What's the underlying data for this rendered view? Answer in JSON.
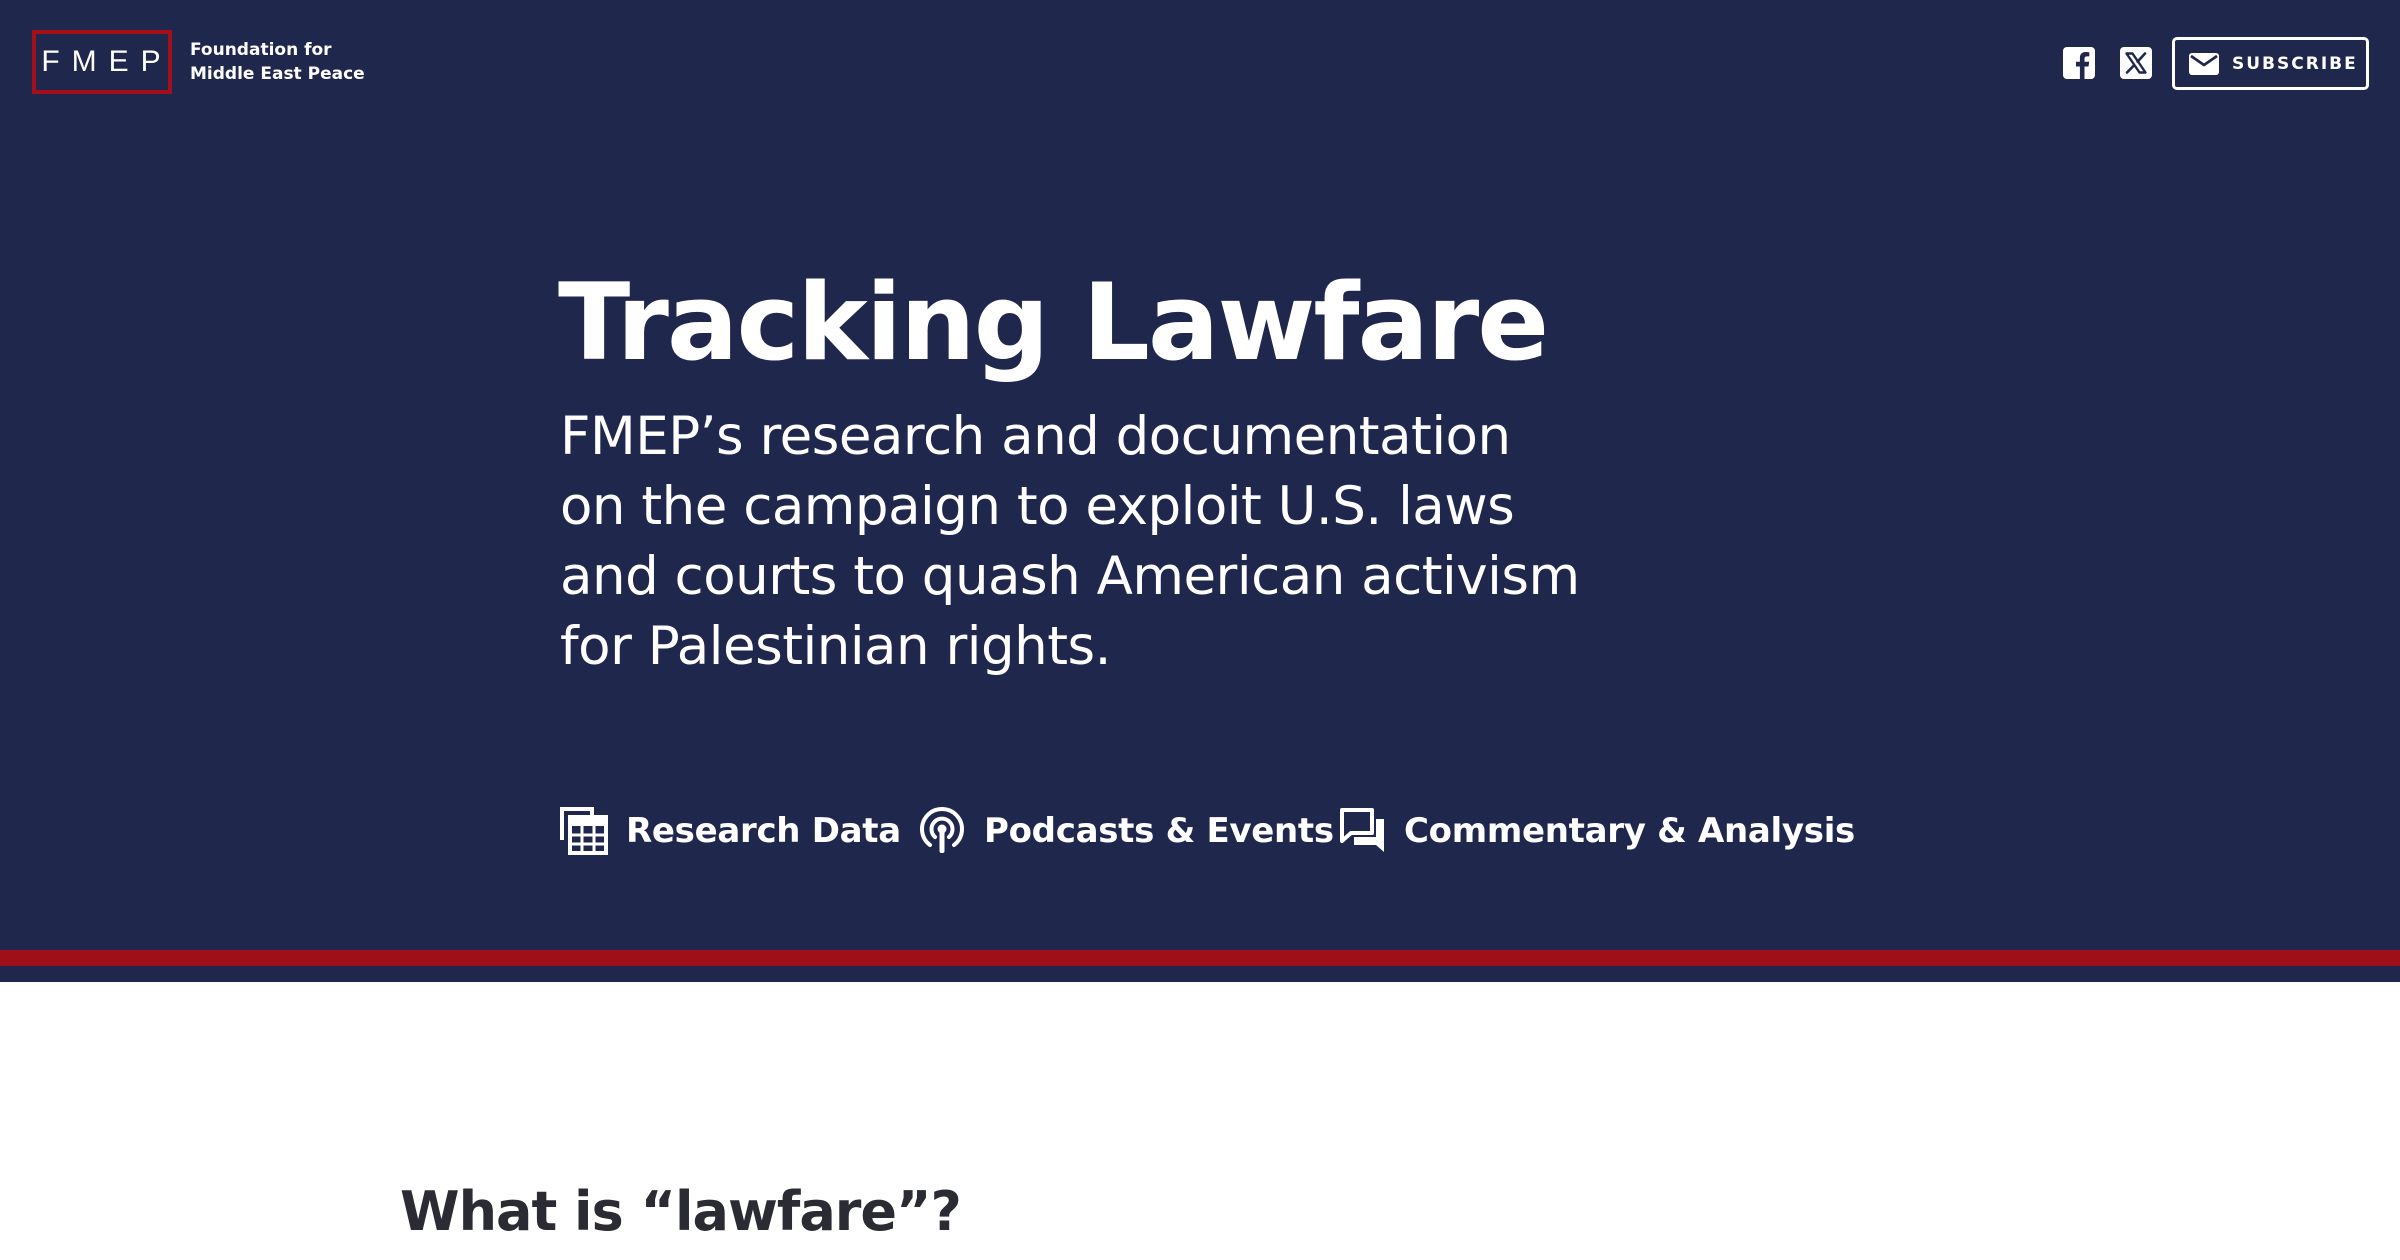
{
  "header": {
    "logo_mark": "FMEP",
    "logo_name_line1": "Foundation for",
    "logo_name_line2": "Middle East Peace",
    "social_icons": [
      "facebook-icon",
      "x-twitter-icon"
    ],
    "subscribe_label": "SUBSCRIBE",
    "subscribe_icon": "envelope-icon"
  },
  "hero": {
    "title": "Tracking Lawfare",
    "subtitle": "FMEP’s research and documentation on the campaign to exploit U.S. laws and courts to quash American activism for Palestinian rights.",
    "links": [
      {
        "label": "Research Data",
        "icon": "spreadsheet-icon"
      },
      {
        "label": "Podcasts & Events",
        "icon": "podcast-icon"
      },
      {
        "label": "Commentary & Analysis",
        "icon": "chat-bubbles-icon"
      }
    ]
  },
  "content": {
    "section_heading": "What is “lawfare”?"
  },
  "colors": {
    "navy": "#20274d",
    "red": "#9e0f1a",
    "white": "#ffffff",
    "text_dark": "#2b2b33"
  }
}
